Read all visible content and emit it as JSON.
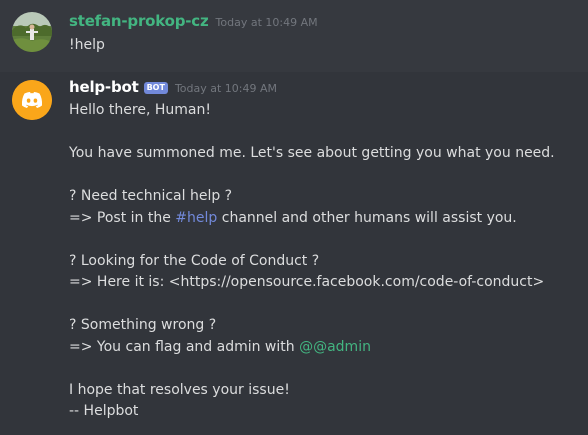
{
  "messages": {
    "user": {
      "username": "stefan-prokop-cz",
      "timestamp": "Today at 10:49 AM",
      "text": "!help",
      "color": "#43b581"
    },
    "bot": {
      "username": "help-bot",
      "tag": "BOT",
      "timestamp": "Today at 10:49 AM",
      "greeting": "Hello there, Human!",
      "summoned": "You have summoned me. Let's see about getting you what you need.",
      "tech_question": "? Need technical help ?",
      "tech_answer_prefix": "=> Post in the ",
      "tech_channel": "#help",
      "tech_answer_suffix": " channel and other humans will assist you.",
      "coc_question": "? Looking for the Code of Conduct ?",
      "coc_answer": "=> Here it is: <https://opensource.facebook.com/code-of-conduct>",
      "wrong_question": "? Something wrong ?",
      "wrong_answer_prefix": "=> You can flag and admin with ",
      "wrong_mention": "@@admin",
      "resolve": "I hope that resolves your issue!",
      "signature": "-- Helpbot",
      "avatar_color": "#faa61a",
      "tag_color": "#7289da"
    }
  },
  "colors": {
    "background": "#36393f",
    "hover_background": "#32353b",
    "text": "#dcddde",
    "timestamp": "#72767d",
    "channel_mention": "#7289da",
    "role_mention": "#43b581"
  },
  "icons": {
    "user_avatar": "nature-photo-avatar",
    "bot_avatar": "discord-logo-icon"
  }
}
